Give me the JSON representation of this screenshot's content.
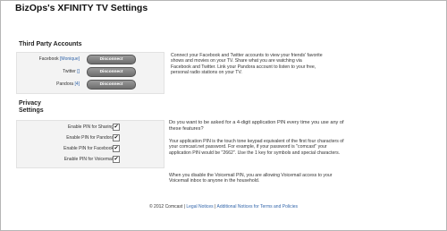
{
  "page": {
    "title": "BizOps's XFINITY TV Settings"
  },
  "third_party": {
    "title": "Third Party Accounts",
    "accounts": [
      {
        "name": "Facebook",
        "user": "Monique",
        "button": "Disconnect"
      },
      {
        "name": "Twitter",
        "user": "",
        "button": "Disconnect"
      },
      {
        "name": "Pandora",
        "user": "4",
        "button": "Disconnect"
      }
    ],
    "description": "Connect your Facebook and Twitter accounts to view your friends' favorite shows and movies on your TV. Share what you are watching via Facebook and Twitter. Link your Pandora account to listen to your free, personal radio stations on your TV."
  },
  "privacy": {
    "title_line1": "Privacy",
    "title_line2": "Settings",
    "options": [
      {
        "label": "Enable PIN for Sharing",
        "checked": true
      },
      {
        "label": "Enable PIN for Pandora",
        "checked": true
      },
      {
        "label": "Enable PIN for Facebook",
        "checked": true
      },
      {
        "label": "Enable PIN for Voicemail",
        "checked": true
      }
    ],
    "question": "Do you want to be asked for a 4-digit application PIN every time you use any of these features?",
    "explanation": "Your application PIN is the touch tone keypad equivalent of the first four characters of your comcast.net password. For example, if your password is \"comcast\" your application PIN would be \"2662\". Use the 1 key for symbols and special characters.",
    "voicemail_note": "When you disable the Voicemail PIN, you are allowing Voicemail access to your Voicemail inbox to anyone in the household."
  },
  "footer": {
    "copyright": "© 2012 Comcast",
    "separator": " | ",
    "legal_link": "Legal Notices",
    "separator2": " | ",
    "terms_link": "Additional Notices for Terms and Policies"
  }
}
